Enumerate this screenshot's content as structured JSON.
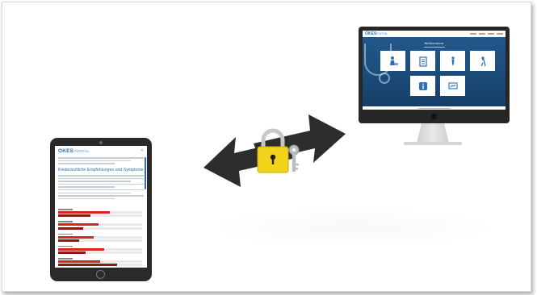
{
  "tablet": {
    "logo": "OKES",
    "logo_sub": "PORTAL",
    "close_icon": "close-icon",
    "heading": "Kinderärztliche Empfehlungen und Symptome",
    "bar_groups": [
      {
        "fills": [
          0.62,
          0.38
        ]
      },
      {
        "fills": [
          0.48,
          0.3
        ]
      },
      {
        "fills": [
          0.42,
          0.25
        ]
      },
      {
        "fills": [
          0.55,
          0.33
        ]
      },
      {
        "fills": [
          0.5,
          0.7
        ]
      },
      {
        "fills": [
          0.45,
          0.6
        ]
      }
    ]
  },
  "monitor": {
    "logo": "OKES",
    "logo_sub": "PORTAL",
    "title": "Willkommen",
    "cards": [
      {
        "icon": "doctor-patient-icon"
      },
      {
        "icon": "clipboard-icon"
      },
      {
        "icon": "person-standing-icon"
      },
      {
        "icon": "person-walking-icon"
      },
      {
        "icon": "info-icon"
      },
      {
        "icon": "screen-chart-icon"
      }
    ]
  },
  "center": {
    "arrows_icon": "bidirectional-arrows-icon",
    "lock_icon": "padlock-icon",
    "key_icon": "key-icon"
  },
  "colors": {
    "arrow": "#2d2d2d",
    "lock": "#f2d21b",
    "accent_blue": "#2a6fb8",
    "bar_red": "#d9261c"
  }
}
